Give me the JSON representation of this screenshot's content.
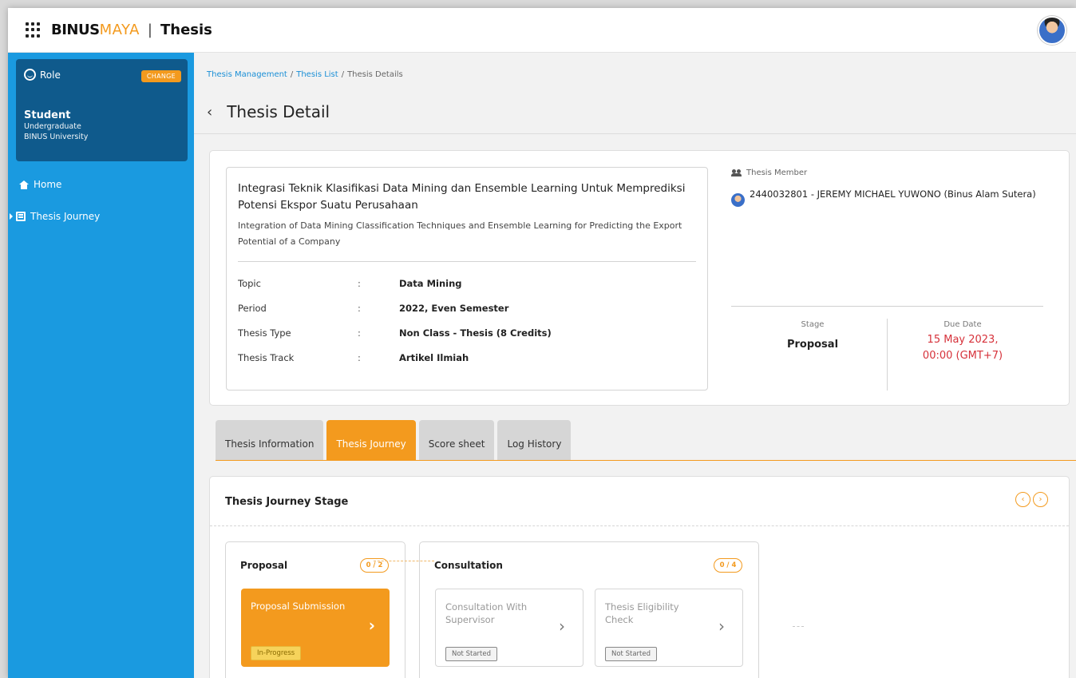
{
  "app": {
    "brand_main": "BINUS",
    "brand_accent": "MAYA",
    "separator": "|",
    "title": "Thesis"
  },
  "sidebar": {
    "role_label": "Role",
    "change_button": "CHANGE",
    "role_name": "Student",
    "role_level": "Undergraduate",
    "role_institution": "BINUS University",
    "items": [
      {
        "label": "Home",
        "icon": "home-icon"
      },
      {
        "label": "Thesis Journey",
        "icon": "book-icon"
      }
    ]
  },
  "breadcrumb": {
    "items": [
      "Thesis Management",
      "Thesis List",
      "Thesis Details"
    ],
    "separator": "/"
  },
  "page": {
    "back_glyph": "‹",
    "title": "Thesis Detail"
  },
  "thesis": {
    "title": "Integrasi Teknik Klasifikasi Data Mining dan Ensemble Learning Untuk Memprediksi Potensi Ekspor Suatu Perusahaan",
    "title_en": "Integration of Data Mining Classification Techniques and Ensemble Learning for Predicting the Export Potential of a Company",
    "fields": [
      {
        "key": "Topic",
        "sep": ":",
        "value": "Data Mining"
      },
      {
        "key": "Period",
        "sep": ":",
        "value": "2022, Even Semester"
      },
      {
        "key": "Thesis Type",
        "sep": ":",
        "value": "Non Class - Thesis (8 Credits)"
      },
      {
        "key": "Thesis Track",
        "sep": ":",
        "value": "Artikel Ilmiah"
      }
    ],
    "member_label": "Thesis Member",
    "member": "2440032801 - JEREMY MICHAEL YUWONO (Binus Alam Sutera)",
    "stage_label": "Stage",
    "stage_value": "Proposal",
    "due_label": "Due Date",
    "due_line1": "15 May 2023,",
    "due_line2": "00:00 (GMT+7)"
  },
  "tabs": [
    {
      "label": "Thesis Information",
      "active": false
    },
    {
      "label": "Thesis Journey",
      "active": true
    },
    {
      "label": "Score sheet",
      "active": false
    },
    {
      "label": "Log History",
      "active": false
    }
  ],
  "journey": {
    "title": "Thesis Journey Stage",
    "prev_glyph": "‹",
    "next_glyph": "›",
    "groups": [
      {
        "title": "Proposal",
        "count": "0 / 2",
        "steps": [
          {
            "name": "Proposal Submission",
            "status": "In-Progress",
            "chevron": "›"
          }
        ]
      },
      {
        "title": "Consultation",
        "count": "0 / 4",
        "steps": [
          {
            "name": "Consultation With Supervisor",
            "status": "Not Started",
            "chevron": "›"
          },
          {
            "name": "Thesis Eligibility Check",
            "status": "Not Started",
            "chevron": "›"
          }
        ]
      }
    ]
  },
  "colors": {
    "sidebar": "#1a9ae0",
    "role_card": "#0f5a8c",
    "accent": "#f39a1e",
    "due_date": "#d6313a",
    "link": "#1a8fd6"
  }
}
